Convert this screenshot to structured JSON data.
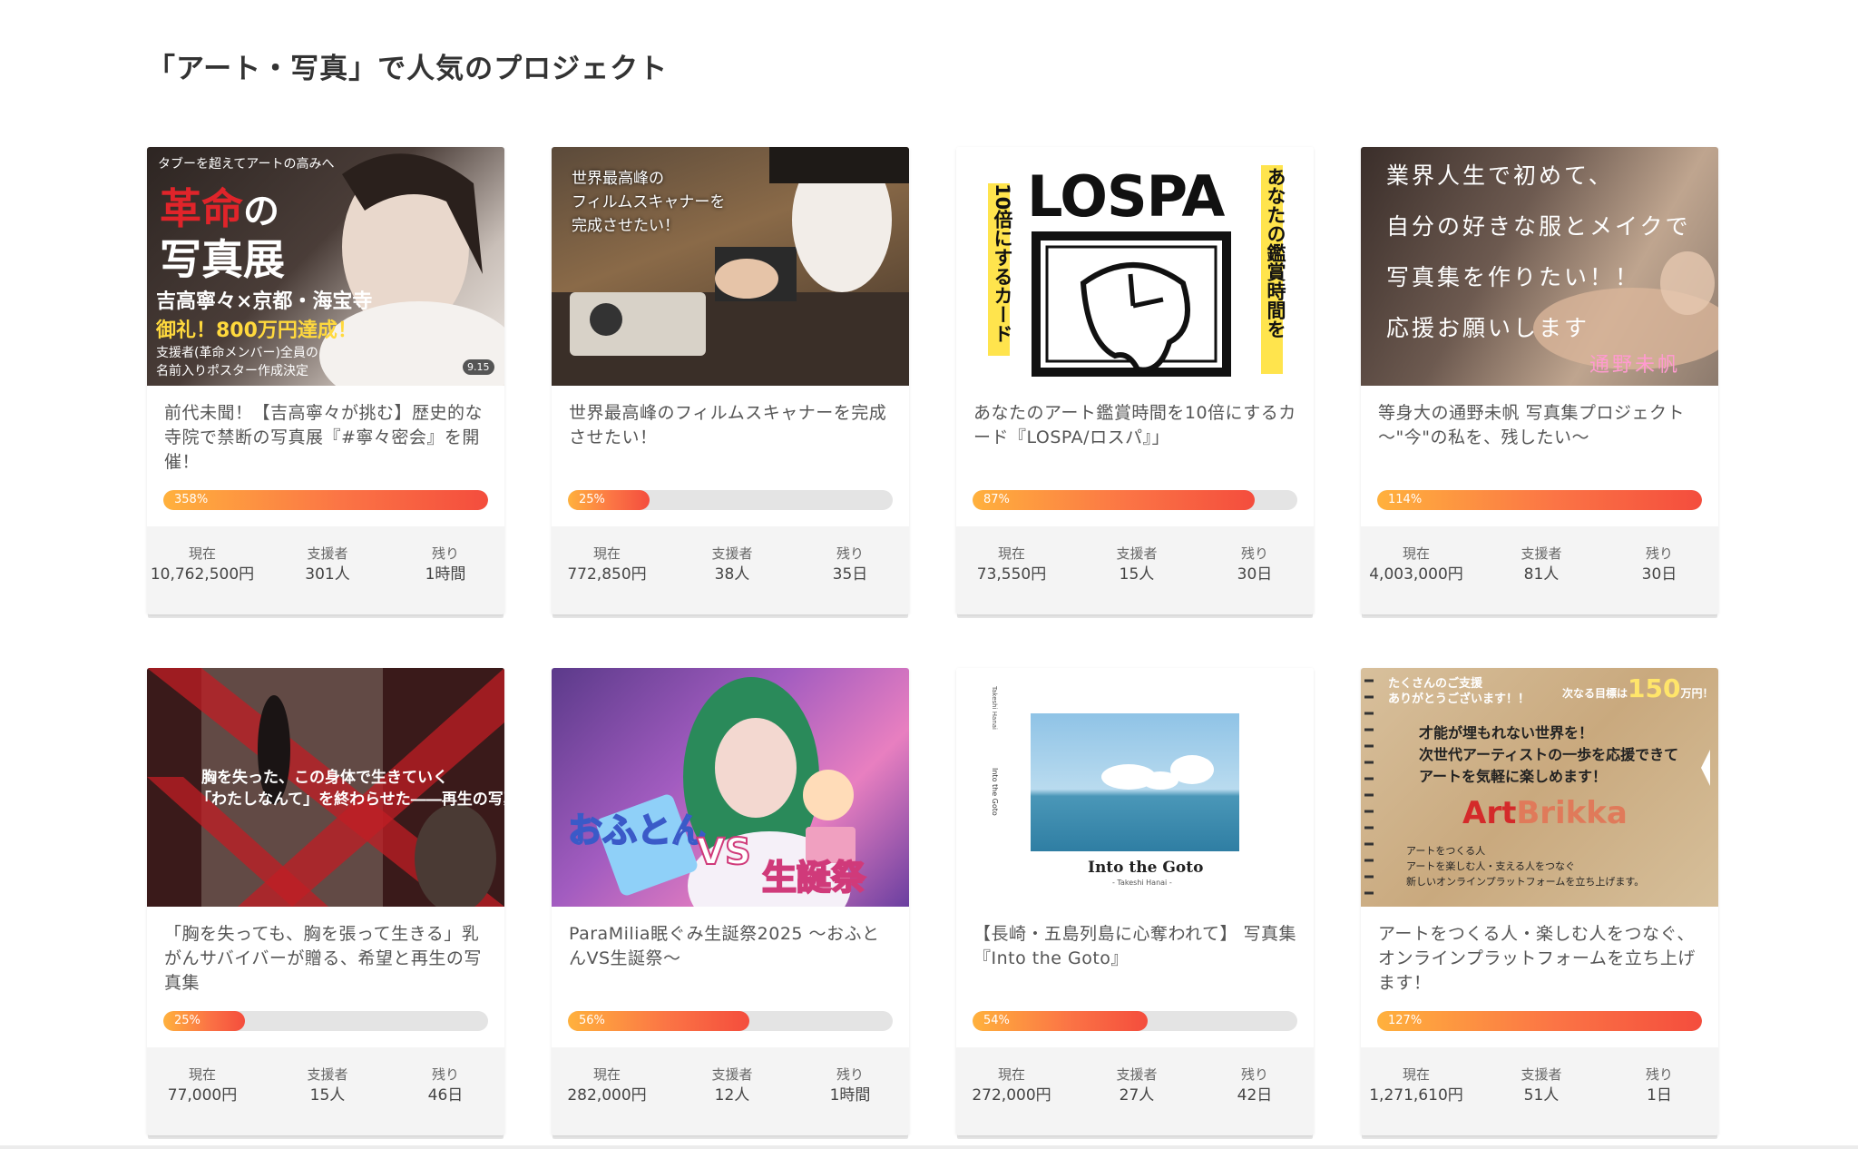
{
  "section": {
    "title": "「アート・写真」で人気のプロジェクト"
  },
  "stat_labels": {
    "current": "現在",
    "supporters": "支援者",
    "remaining": "残り"
  },
  "projects": [
    {
      "title": "前代未聞！【吉高寧々が挑む】歴史的な寺院で禁断の写真展『#寧々密会』を開催！",
      "progress_label": "358%",
      "progress_fraction": 1.0,
      "current": "10,762,500円",
      "supporters": "301人",
      "remaining": "1時間",
      "image_text": [
        "タブーを超えてアートの高みへ",
        "革命",
        "の",
        "写真展",
        "吉高寧々×京都・海宝寺",
        "御礼！800万円達成！",
        "支援者(革命メンバー)全員の",
        "名前入りポスター作成決定",
        "9.15"
      ]
    },
    {
      "title": "世界最高峰のフィルムスキャナーを完成させたい！",
      "progress_label": "25%",
      "progress_fraction": 0.25,
      "current": "772,850円",
      "supporters": "38人",
      "remaining": "35日",
      "image_text": [
        "世界最高峰の",
        "フィルムスキャナーを",
        "完成させたい！"
      ]
    },
    {
      "title": "あなたのアート鑑賞時間を10倍にするカード『LOSPA/ロスパ』」",
      "progress_label": "87%",
      "progress_fraction": 0.87,
      "current": "73,550円",
      "supporters": "15人",
      "remaining": "30日",
      "image_text": [
        "LOSPA",
        "10倍にするカード",
        "あなたの鑑賞時間を"
      ]
    },
    {
      "title": "等身大の通野未帆 写真集プロジェクト～\"今\"の私を、残したい～",
      "progress_label": "114%",
      "progress_fraction": 1.0,
      "current": "4,003,000円",
      "supporters": "81人",
      "remaining": "30日",
      "image_text": [
        "業界人生で初めて、",
        "自分の好きな服とメイクで",
        "写真集を作りたい！！",
        "応援お願いします",
        "通野未帆"
      ]
    },
    {
      "title": "「胸を失っても、胸を張って生きる」乳がんサバイバーが贈る、希望と再生の写真集",
      "progress_label": "25%",
      "progress_fraction": 0.25,
      "current": "77,000円",
      "supporters": "15人",
      "remaining": "46日",
      "image_text": [
        "胸を失った、この身体で生きていく",
        "「わたしなんて」を終わらせた――再生の写真集"
      ]
    },
    {
      "title": "ParaMilia眠ぐみ生誕祭2025 ～おふとんVS生誕祭～",
      "progress_label": "56%",
      "progress_fraction": 0.56,
      "current": "282,000円",
      "supporters": "12人",
      "remaining": "1時間",
      "image_text": [
        "おふとん",
        "VS",
        "生誕祭"
      ]
    },
    {
      "title": "【長崎・五島列島に心奪われて】 写真集『Into the Goto』",
      "progress_label": "54%",
      "progress_fraction": 0.54,
      "current": "272,000円",
      "supporters": "27人",
      "remaining": "42日",
      "image_text": [
        "Into the Goto",
        "- Takeshi Hanai -",
        "Takeshi Hanai",
        "Into the Goto"
      ]
    },
    {
      "title": "アートをつくる人・楽しむ人をつなぐ、オンラインプラットフォームを立ち上げます！",
      "progress_label": "127%",
      "progress_fraction": 1.0,
      "current": "1,271,610円",
      "supporters": "51人",
      "remaining": "1日",
      "image_text": [
        "たくさんのご支援",
        "ありがとうございます！！",
        "次なる目標は",
        "150",
        "万円！",
        "才能が埋もれない世界を！",
        "次世代アーティストの一歩を応援できて",
        "アートを気軽に楽しめます！",
        "Art",
        "Brikka",
        "アートをつくる人",
        "アートを楽しむ人・支える人をつなぐ",
        "新しいオンラインプラットフォームを立ち上げます。"
      ]
    }
  ],
  "colors": {
    "progress_start": "#ffb13d",
    "progress_end": "#f44d3d",
    "progress_track": "#e4e4e4",
    "stats_bg": "#f4f4f4"
  }
}
